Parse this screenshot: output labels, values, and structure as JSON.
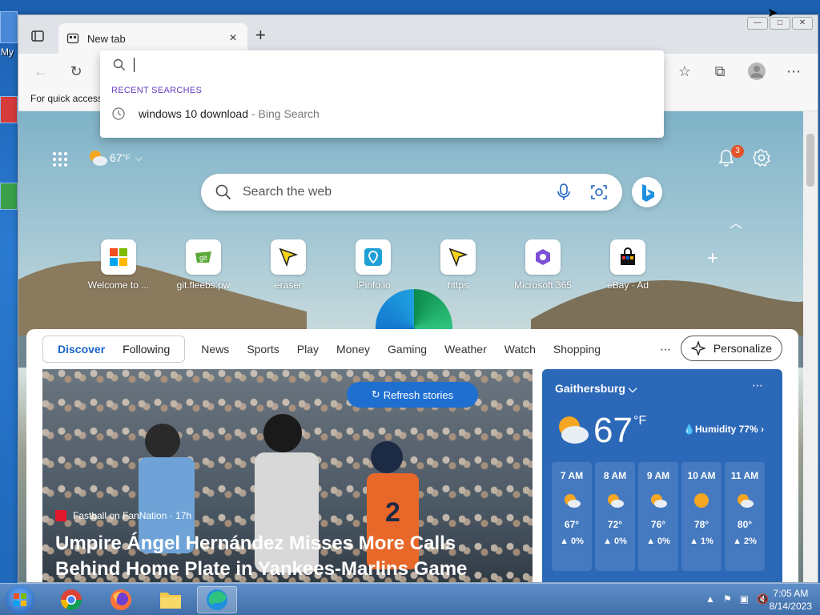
{
  "desktop": {
    "icon_label": "My"
  },
  "window": {
    "tab_title": "New tab",
    "controls": {
      "minimize": "—",
      "maximize": "□",
      "close": "✕"
    }
  },
  "toolbar": {
    "back": "←",
    "refresh": "↻",
    "favorites": "☆",
    "collections": "⧉",
    "more": "⋯"
  },
  "favbar": {
    "text": "For quick access"
  },
  "omnibox": {
    "heading": "RECENT SEARCHES",
    "items": [
      {
        "query": "windows 10 download",
        "source": "- Bing Search"
      }
    ]
  },
  "newtab": {
    "weather_temp": "67",
    "weather_unit": "°F",
    "notification_count": "3",
    "search_placeholder": "Search the web",
    "tiles": [
      {
        "label": "Welcome to ..."
      },
      {
        "label": "git.fleebs.pw"
      },
      {
        "label": "eraser"
      },
      {
        "label": "IPinfo.io"
      },
      {
        "label": "https"
      },
      {
        "label": "Microsoft 365"
      },
      {
        "label": "eBay · Ad"
      }
    ]
  },
  "feed": {
    "pill_tabs": [
      "Discover",
      "Following"
    ],
    "nav": [
      "News",
      "Sports",
      "Play",
      "Money",
      "Gaming",
      "Weather",
      "Watch",
      "Shopping"
    ],
    "more": "⋯",
    "personalize": "Personalize",
    "refresh": "Refresh stories",
    "hero": {
      "source": "Fastball on FanNation · 17h",
      "title": "Umpire Ángel Hernández Misses More Calls Behind Home Plate in Yankees-Marlins Game"
    }
  },
  "weather": {
    "city": "Gaithersburg",
    "temp": "67",
    "unit": "°F",
    "humidity": "Humidity 77%",
    "hours": [
      {
        "time": "7 AM",
        "temp": "67°",
        "precip": "▲ 0%"
      },
      {
        "time": "8 AM",
        "temp": "72°",
        "precip": "▲ 0%"
      },
      {
        "time": "9 AM",
        "temp": "76°",
        "precip": "▲ 0%"
      },
      {
        "time": "10 AM",
        "temp": "78°",
        "precip": "▲ 1%"
      },
      {
        "time": "11 AM",
        "temp": "80°",
        "precip": "▲ 2%"
      }
    ]
  },
  "taskbar": {
    "time": "7:05 AM",
    "date": "8/14/2023"
  }
}
